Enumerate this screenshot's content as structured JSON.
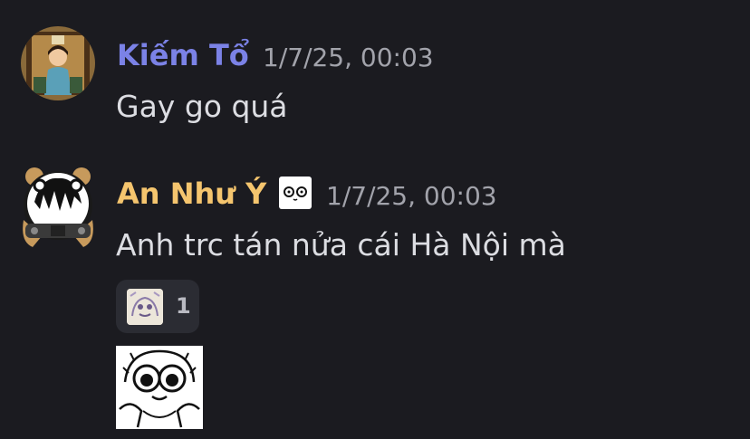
{
  "messages": [
    {
      "author": "Kiếm Tổ",
      "author_color": "#7b82e6",
      "timestamp": "1/7/25, 00:03",
      "text": "Gay go quá"
    },
    {
      "author": "An Như Ý",
      "author_color": "#f5c56e",
      "timestamp": "1/7/25, 00:03",
      "text": "Anh trc tán nửa cái Hà Nội mà",
      "reaction": {
        "count": "1"
      }
    }
  ],
  "colors": {
    "background": "#1b1b20",
    "message_text": "#dcdde2",
    "timestamp": "#a2a3ab",
    "reaction_bg": "#2b2c33"
  }
}
